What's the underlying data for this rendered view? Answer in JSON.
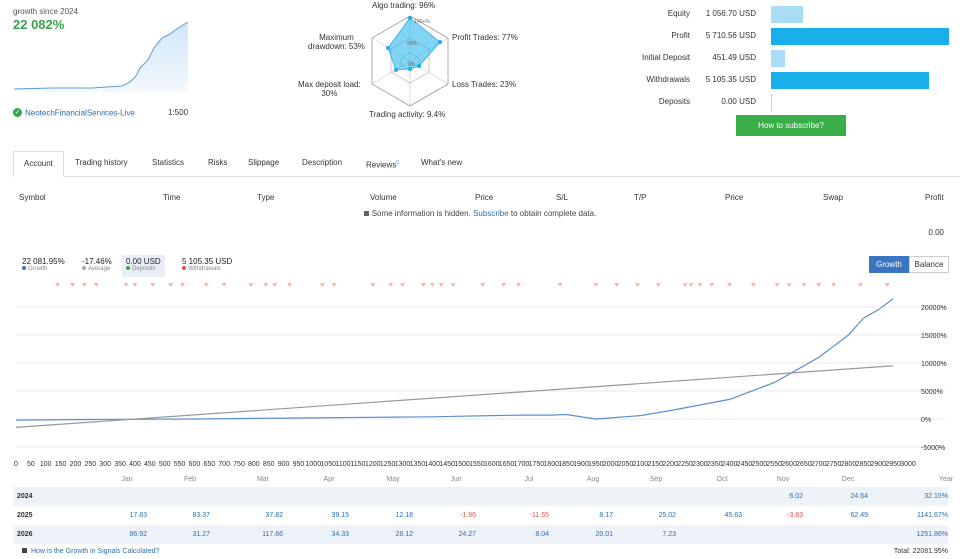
{
  "summary": {
    "growth_label": "growth since 2024",
    "growth_value": "22 082%",
    "account_name": "NeotechFinancialServices-Live",
    "leverage": "1:500"
  },
  "radar": {
    "top_label": "Algo trading: 96%",
    "right_top_label": "Profit Trades: 77%",
    "right_bottom_label": "Loss Trades: 23%",
    "bottom_label": "Trading activity: 9.4%",
    "left_bottom_label": "Max deposit load:\n30%",
    "left_top_label": "Maximum\ndrawdown: 53%",
    "rings": [
      "100+%",
      "50%",
      "0%"
    ]
  },
  "stats": [
    {
      "label": "Equity",
      "value": "1 056.70 USD",
      "fraction": 0.18,
      "color": "#a9ddf5"
    },
    {
      "label": "Profit",
      "value": "5 710.56 USD",
      "fraction": 1.0,
      "color": "#19b0ea"
    },
    {
      "label": "Initial Deposit",
      "value": "451.49 USD",
      "fraction": 0.08,
      "color": "#a9ddf5"
    },
    {
      "label": "Withdrawals",
      "value": "5 105.35 USD",
      "fraction": 0.89,
      "color": "#19b0ea"
    },
    {
      "label": "Deposits",
      "value": "0.00 USD",
      "fraction": 0.0,
      "color": "#a9ddf5"
    }
  ],
  "subscribe_label": "How to subscribe?",
  "tabs": [
    "Account",
    "Trading history",
    "Statistics",
    "Risks",
    "Slippage",
    "Description",
    "Reviews",
    "What's new"
  ],
  "reviews_badge": "0",
  "trade_table": {
    "headers": [
      "Symbol",
      "Time",
      "Type",
      "Volume",
      "Price",
      "S/L",
      "T/P",
      "Price",
      "Swap",
      "Profit"
    ],
    "hidden_note_pre": "Some information is hidden.",
    "hidden_note_link": "Subscribe",
    "hidden_note_post": "to obtain complete data.",
    "total_profit": "0.00"
  },
  "chart_summary": [
    {
      "value": "22 081.95%",
      "label": "Growth",
      "color": "#3a76c0"
    },
    {
      "value": "-17.46%",
      "label": "Average",
      "color": "#aaaaaa"
    },
    {
      "value": "0.00 USD",
      "label": "Deposits",
      "color": "#39ad48"
    },
    {
      "value": "5 105.35 USD",
      "label": "Withdrawals",
      "color": "#d9534f"
    }
  ],
  "chart_buttons": {
    "growth": "Growth",
    "balance": "Balance"
  },
  "chart_data": {
    "type": "line",
    "x_ticks": [
      "0",
      "50",
      "100",
      "150",
      "200",
      "250",
      "300",
      "350",
      "400",
      "450",
      "500",
      "550",
      "600",
      "650",
      "700",
      "750",
      "800",
      "850",
      "900",
      "950",
      "1000",
      "1050",
      "1100",
      "1150",
      "1200",
      "1250",
      "1300",
      "1350",
      "1400",
      "1450",
      "1500",
      "1550",
      "1600",
      "1650",
      "1700",
      "1750",
      "1800",
      "1850",
      "1900",
      "1950",
      "2000",
      "2050",
      "2100",
      "2150",
      "2200",
      "2250",
      "2300",
      "2350",
      "2400",
      "2450",
      "2500",
      "2550",
      "2600",
      "2650",
      "2700",
      "2750",
      "2800",
      "2850",
      "2900",
      "2950",
      "3000"
    ],
    "y_ticks": [
      "20000%",
      "15000%",
      "10000%",
      "5000%",
      "0%",
      "-5000%"
    ],
    "ylim": [
      -5000,
      20000
    ],
    "xlim": [
      0,
      3000
    ],
    "series": [
      {
        "color": "#5b8fd0",
        "x": [
          0,
          200,
          400,
          600,
          800,
          1000,
          1200,
          1400,
          1500,
          1600,
          1700,
          1800,
          1850,
          1950,
          2000,
          2100,
          2200,
          2300,
          2400,
          2450,
          2500,
          2550,
          2600,
          2650,
          2700,
          2750,
          2800,
          2850,
          2900,
          2950
        ],
        "y": [
          -200,
          -100,
          -50,
          0,
          100,
          200,
          300,
          400,
          500,
          600,
          700,
          700,
          800,
          0,
          200,
          600,
          1500,
          2500,
          3500,
          4500,
          5500,
          6500,
          8000,
          9500,
          11000,
          13000,
          15000,
          18000,
          19500,
          21500
        ]
      },
      {
        "color": "#999999",
        "x": [
          0,
          2950
        ],
        "y": [
          -1500,
          9500
        ]
      }
    ],
    "marker_x": [
      140,
      190,
      230,
      270,
      370,
      400,
      460,
      520,
      560,
      640,
      700,
      790,
      840,
      870,
      920,
      1030,
      1070,
      1200,
      1260,
      1300,
      1370,
      1400,
      1430,
      1470,
      1570,
      1640,
      1690,
      1830,
      1950,
      2020,
      2090,
      2160,
      2250,
      2270,
      2300,
      2340,
      2400,
      2480,
      2560,
      2600,
      2650,
      2700,
      2750,
      2840,
      2930
    ]
  },
  "monthly": {
    "months": [
      "Jan",
      "Feb",
      "Mar",
      "Apr",
      "May",
      "Jun",
      "Jul",
      "Aug",
      "Sep",
      "Oct",
      "Nov",
      "Dec",
      "Year"
    ],
    "rows": [
      {
        "year": "2024",
        "values": [
          "",
          "",
          "",
          "",
          "",
          "",
          "",
          "",
          "",
          "",
          "6.02",
          "24.64",
          "32.15%"
        ]
      },
      {
        "year": "2025",
        "values": [
          "17.83",
          "83.37",
          "37.82",
          "39.15",
          "12.18",
          "-1.86",
          "-11.55",
          "8.17",
          "25.02",
          "45.63",
          "-3.83",
          "62.49",
          "1141.67%"
        ]
      },
      {
        "year": "2026",
        "values": [
          "86.92",
          "31.27",
          "117.66",
          "34.33",
          "28.12",
          "24.27",
          "8.04",
          "20.01",
          "7.23",
          "",
          "",
          "",
          "1251.86%"
        ]
      }
    ],
    "footer_link": "How is the Growth in Signals Calculated?",
    "footer_total": "Total: 22081.95%"
  }
}
